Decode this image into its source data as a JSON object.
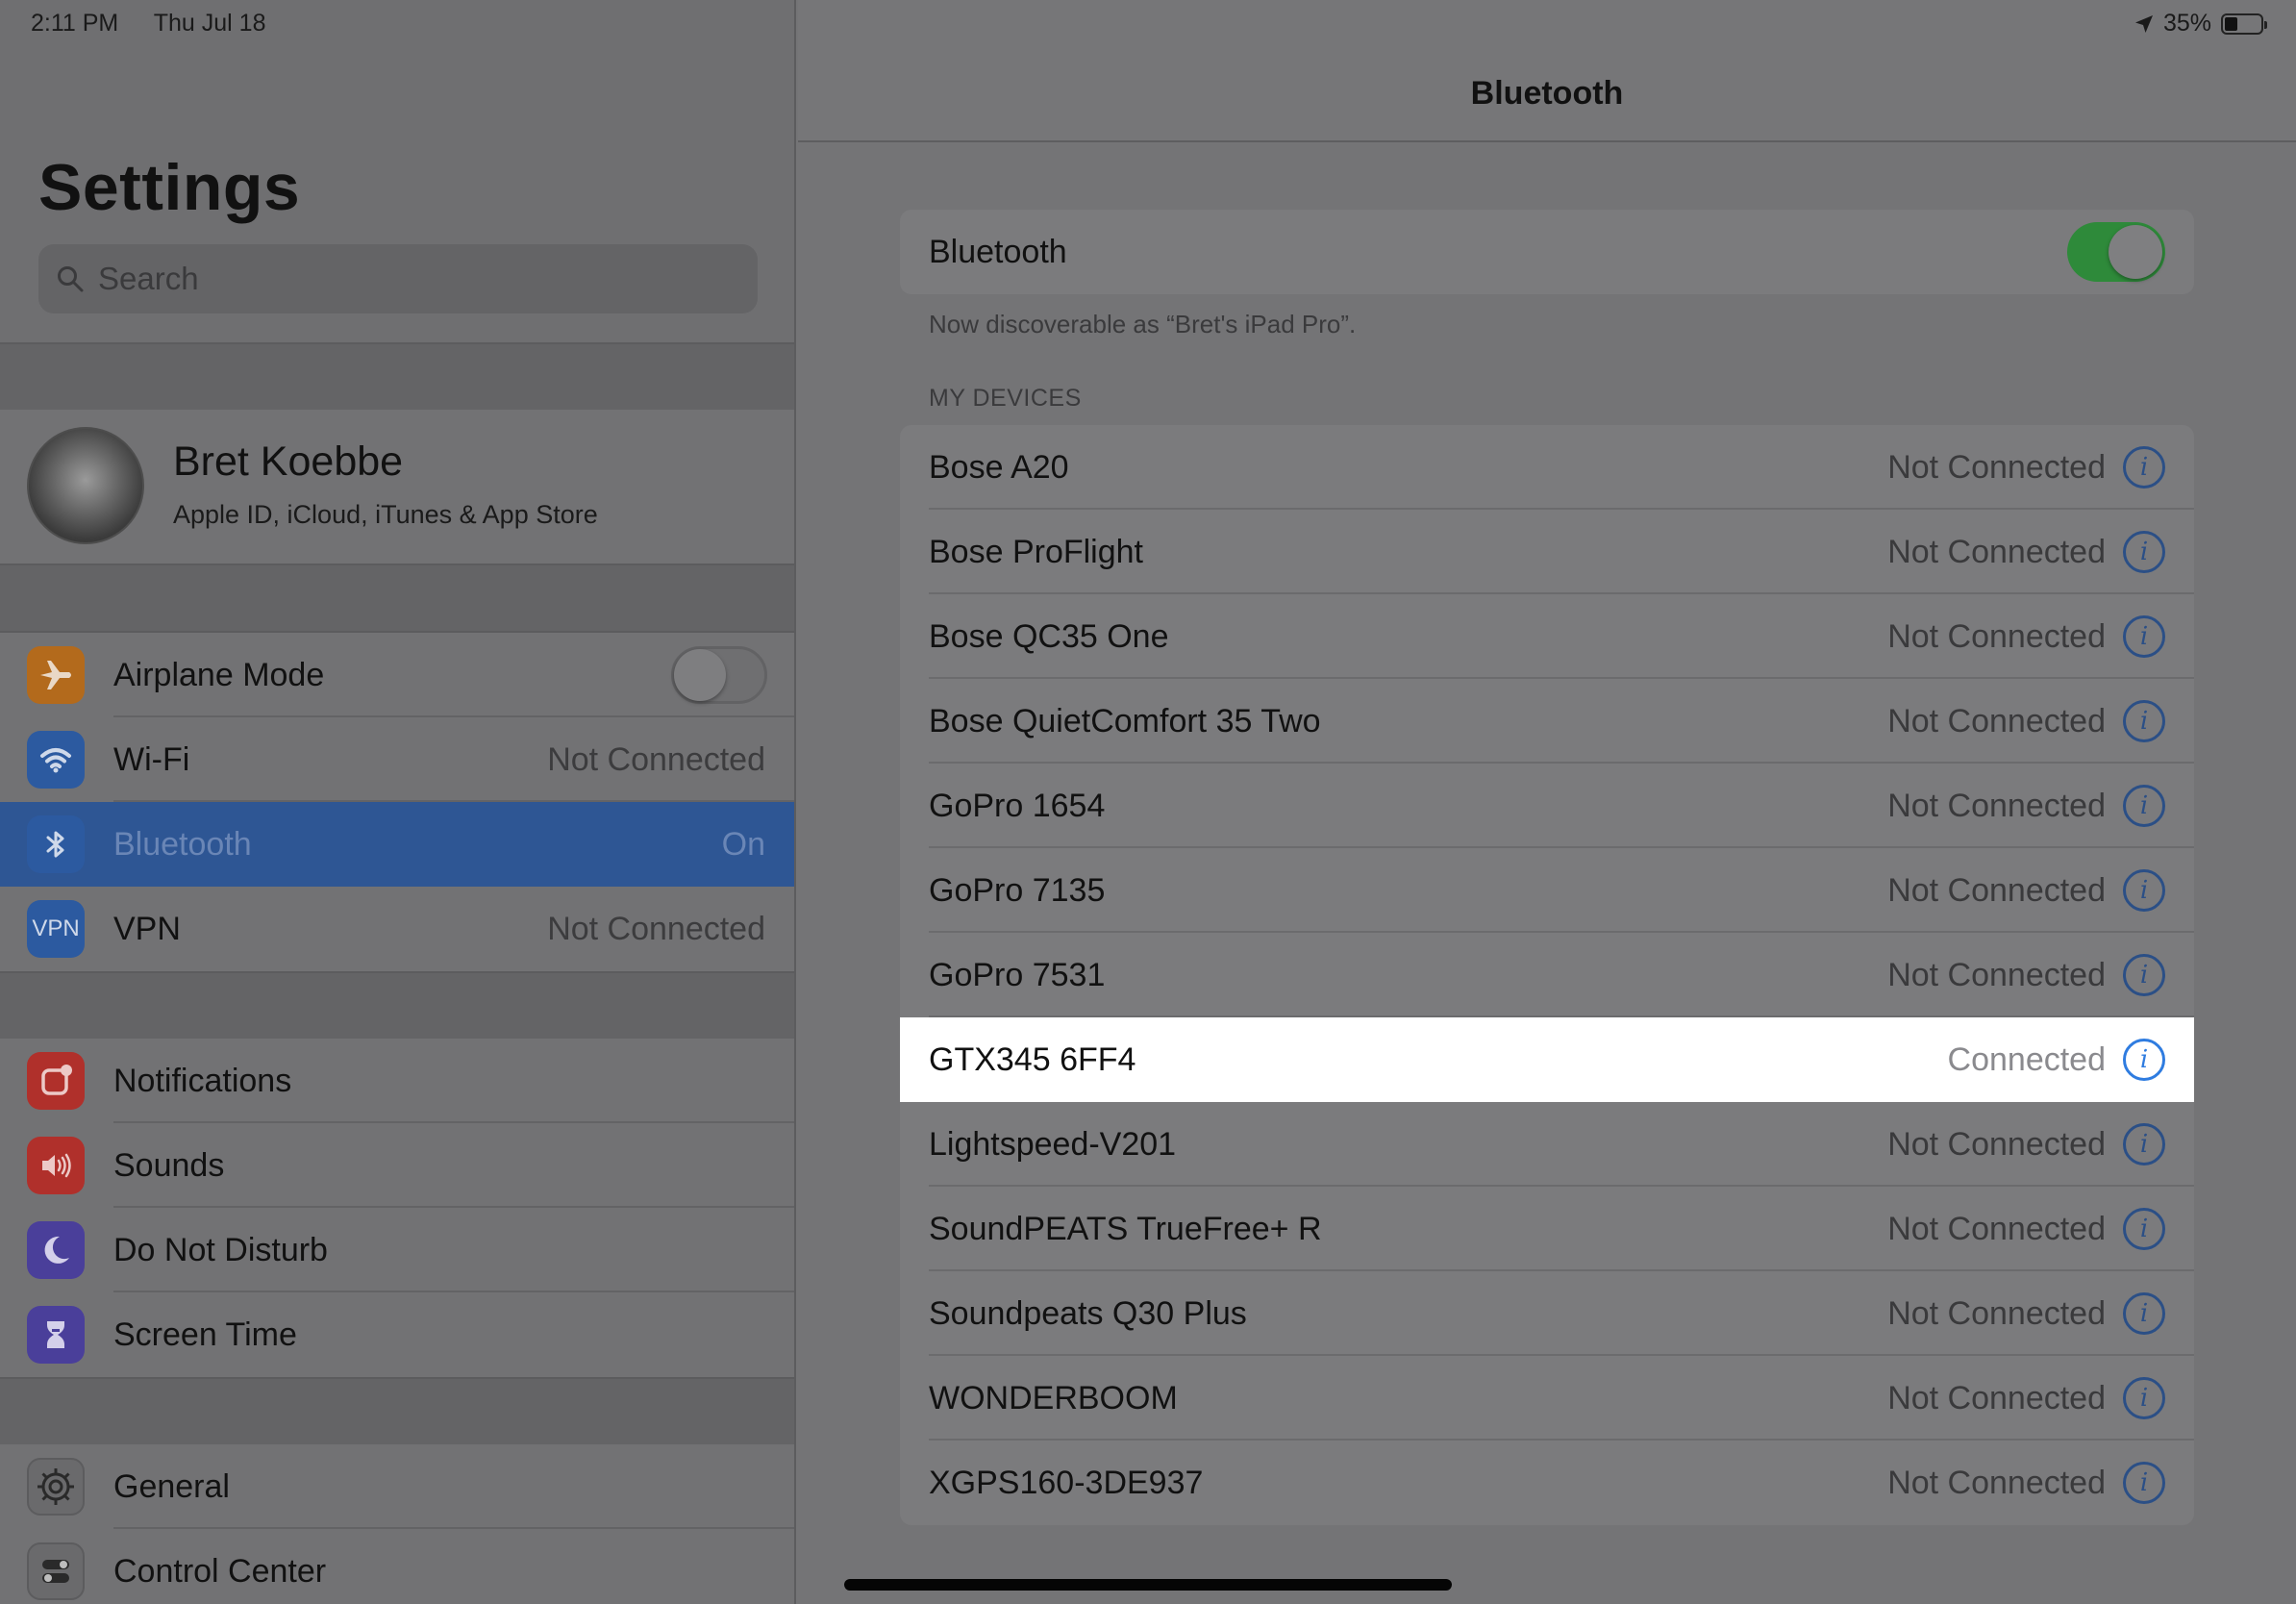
{
  "status_bar": {
    "time": "2:11 PM",
    "date": "Thu Jul 18",
    "battery": "35%",
    "battery_level": 0.35
  },
  "sidebar": {
    "title": "Settings",
    "search": {
      "placeholder": "Search"
    },
    "profile": {
      "name": "Bret Koebbe",
      "subtitle": "Apple ID, iCloud, iTunes & App Store"
    },
    "group1": [
      {
        "label": "Airplane Mode",
        "value": "",
        "icon": "airplane-icon",
        "color": "#b36a1c",
        "toggle": false
      },
      {
        "label": "Wi-Fi",
        "value": "Not Connected",
        "icon": "wifi-icon",
        "color": "#2c5aa0"
      },
      {
        "label": "Bluetooth",
        "value": "On",
        "icon": "bluetooth-icon",
        "color": "#2c5aa0",
        "selected": true
      },
      {
        "label": "VPN",
        "value": "Not Connected",
        "icon": "vpn-icon",
        "color": "#2c5aa0",
        "badge": "VPN"
      }
    ],
    "group2": [
      {
        "label": "Notifications",
        "icon": "notifications-icon",
        "color": "#b0302b"
      },
      {
        "label": "Sounds",
        "icon": "sounds-icon",
        "color": "#b0302b"
      },
      {
        "label": "Do Not Disturb",
        "icon": "moon-icon",
        "color": "#4a3f9a"
      },
      {
        "label": "Screen Time",
        "icon": "hourglass-icon",
        "color": "#4a3f9a"
      }
    ],
    "group3": [
      {
        "label": "General",
        "icon": "gear-icon",
        "color": "#6a6a6c"
      },
      {
        "label": "Control Center",
        "icon": "switches-icon",
        "color": "#6a6a6c"
      }
    ]
  },
  "detail": {
    "title": "Bluetooth",
    "bluetooth_label": "Bluetooth",
    "bluetooth_on": true,
    "discoverable_note": "Now discoverable as “Bret's iPad Pro”.",
    "section_header": "MY DEVICES",
    "devices": [
      {
        "name": "Bose A20",
        "status": "Not Connected"
      },
      {
        "name": "Bose ProFlight",
        "status": "Not Connected"
      },
      {
        "name": "Bose QC35 One",
        "status": "Not Connected"
      },
      {
        "name": "Bose QuietComfort 35 Two",
        "status": "Not Connected"
      },
      {
        "name": "GoPro 1654",
        "status": "Not Connected"
      },
      {
        "name": "GoPro 7135",
        "status": "Not Connected"
      },
      {
        "name": "GoPro 7531",
        "status": "Not Connected"
      },
      {
        "name": "GTX345 6FF4",
        "status": "Connected",
        "highlight": true
      },
      {
        "name": "Lightspeed-V201",
        "status": "Not Connected"
      },
      {
        "name": "SoundPEATS TrueFree+ R",
        "status": "Not Connected"
      },
      {
        "name": "Soundpeats Q30 Plus",
        "status": "Not Connected"
      },
      {
        "name": "WONDERBOOM",
        "status": "Not Connected"
      },
      {
        "name": "XGPS160-3DE937",
        "status": "Not Connected"
      }
    ]
  },
  "colors": {
    "accent": "#2f7ce0",
    "toggle_on": "#2e8a3a",
    "selection": "#2e5694"
  }
}
